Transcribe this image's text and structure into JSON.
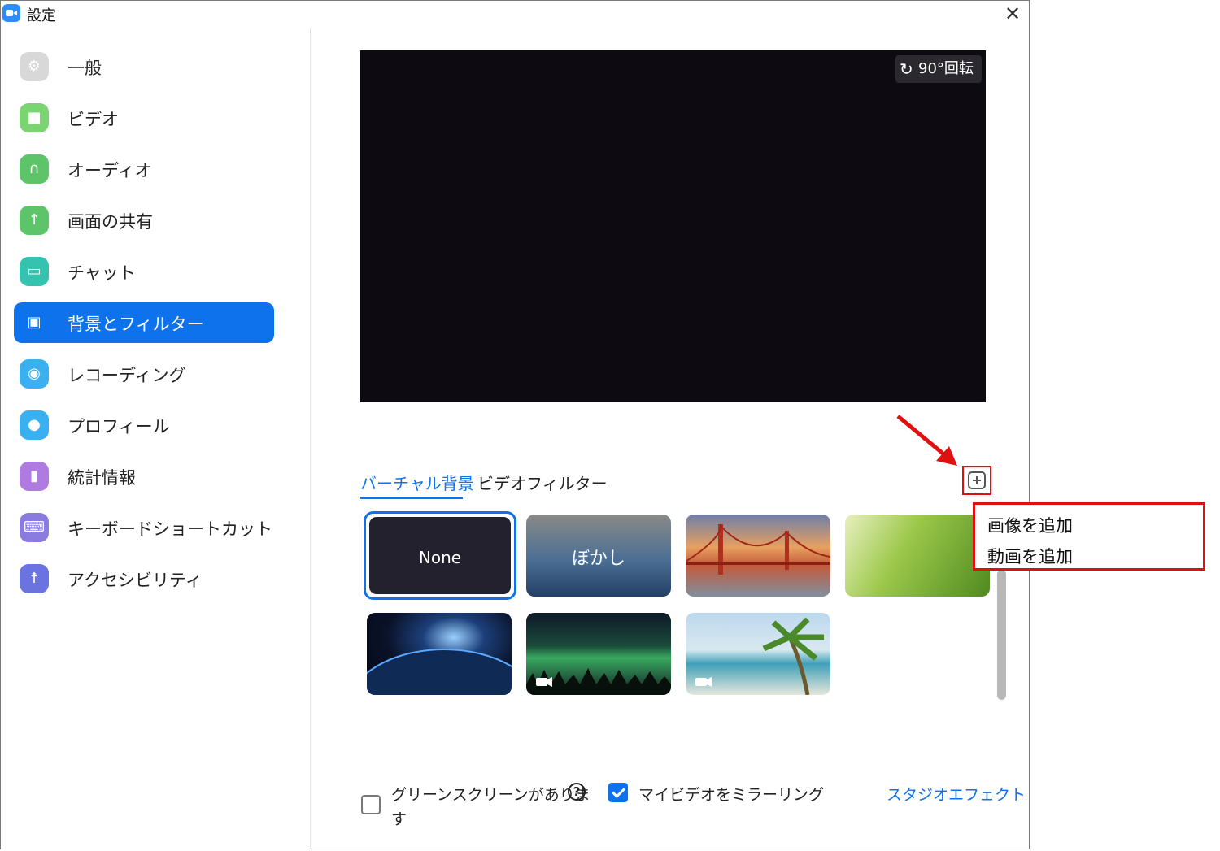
{
  "window": {
    "title": "設定"
  },
  "sidebar": {
    "items": [
      {
        "label": "一般",
        "icon": "gear-icon",
        "color": "#d8d8d8",
        "glyph": "⚙"
      },
      {
        "label": "ビデオ",
        "icon": "video-camera-icon",
        "color": "#7bd472",
        "glyph": "▶"
      },
      {
        "label": "オーディオ",
        "icon": "headphones-icon",
        "color": "#5ec46a",
        "glyph": "∩"
      },
      {
        "label": "画面の共有",
        "icon": "share-screen-icon",
        "color": "#5ec46a",
        "glyph": "↑"
      },
      {
        "label": "チャット",
        "icon": "chat-icon",
        "color": "#35c3b0",
        "glyph": "▭"
      },
      {
        "label": "背景とフィルター",
        "icon": "background-icon",
        "color": "#0e72ed",
        "glyph": "▣",
        "active": true
      },
      {
        "label": "レコーディング",
        "icon": "record-icon",
        "color": "#3ab0f0",
        "glyph": "◉"
      },
      {
        "label": "プロフィール",
        "icon": "profile-icon",
        "color": "#3ab0f0",
        "glyph": "●"
      },
      {
        "label": "統計情報",
        "icon": "statistics-icon",
        "color": "#b07be0",
        "glyph": "▮"
      },
      {
        "label": "キーボードショートカット",
        "icon": "keyboard-icon",
        "color": "#8a7be0",
        "glyph": "⌨"
      },
      {
        "label": "アクセシビリティ",
        "icon": "accessibility-icon",
        "color": "#6a73e0",
        "glyph": "☨"
      }
    ]
  },
  "preview": {
    "rotate_label": "90°回転"
  },
  "tabs": {
    "virtual_bg": "バーチャル背景",
    "video_filter": "ビデオフィルター"
  },
  "add_menu": {
    "add_image": "画像を追加",
    "add_video": "動画を追加"
  },
  "backgrounds": [
    {
      "label": "None",
      "selected": true
    },
    {
      "label": "ぼかし"
    },
    {
      "label": ""
    },
    {
      "label": ""
    },
    {
      "label": ""
    },
    {
      "label": ""
    },
    {
      "label": ""
    }
  ],
  "options": {
    "green_screen": "グリーンスクリーンがありま",
    "green_screen_line2": "す",
    "green_screen_checked": false,
    "help": "?",
    "mirror": "マイビデオをミラーリング",
    "mirror_checked": true,
    "studio_effects": "スタジオエフェクト"
  },
  "colors": {
    "accent": "#0e72ed",
    "highlight_red": "#e01010"
  }
}
